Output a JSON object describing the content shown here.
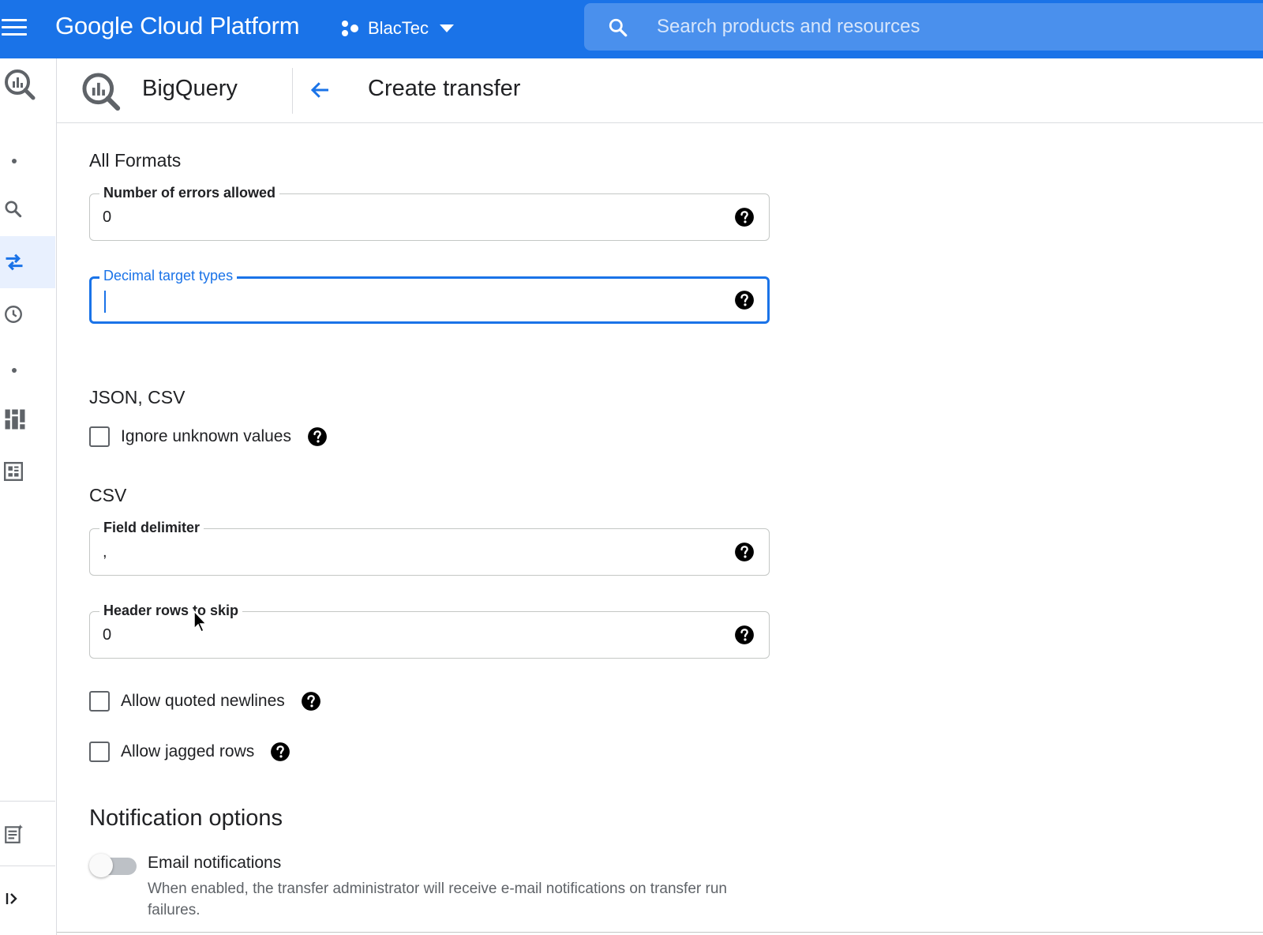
{
  "topbar": {
    "brand": "Google Cloud Platform",
    "project": "BlacTec",
    "search_placeholder": "Search products and resources",
    "accent_color": "#1a73e8"
  },
  "rail": {
    "items": [
      {
        "name": "bigquery-logo-icon"
      },
      {
        "name": "search-icon"
      },
      {
        "name": "transfers-icon",
        "active": true
      },
      {
        "name": "history-icon"
      },
      {
        "name": "dashboard-icon"
      },
      {
        "name": "analytics-hub-icon"
      },
      {
        "name": "release-notes-icon"
      },
      {
        "name": "expand-icon"
      }
    ]
  },
  "subheader": {
    "product": "BigQuery",
    "page_title": "Create transfer"
  },
  "form": {
    "all_formats_heading": "All Formats",
    "errors_allowed": {
      "label": "Number of errors allowed",
      "value": "0"
    },
    "decimal_types": {
      "label": "Decimal target types",
      "value": ""
    },
    "json_csv_heading": "JSON, CSV",
    "ignore_unknown": {
      "label": "Ignore unknown values",
      "checked": false
    },
    "csv_heading": "CSV",
    "field_delimiter": {
      "label": "Field delimiter",
      "value": ","
    },
    "header_rows": {
      "label": "Header rows to skip",
      "value": "0"
    },
    "quoted_newlines": {
      "label": "Allow quoted newlines",
      "checked": false
    },
    "jagged_rows": {
      "label": "Allow jagged rows",
      "checked": false
    }
  },
  "notifications": {
    "heading": "Notification options",
    "email_label": "Email notifications",
    "email_enabled": false,
    "email_desc": "When enabled, the transfer administrator will receive e-mail notifications on transfer run failures."
  }
}
